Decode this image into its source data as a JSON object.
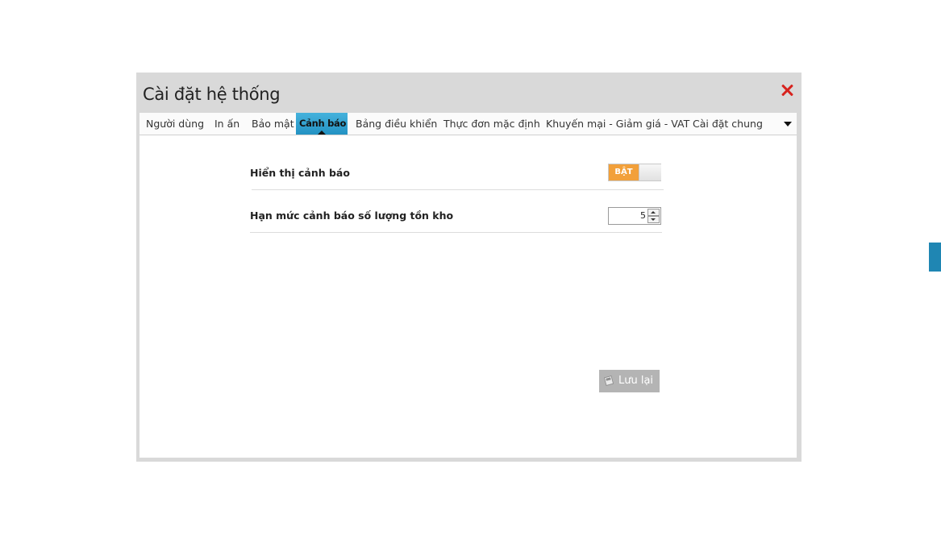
{
  "dialog": {
    "title": "Cài đặt hệ thống",
    "close_icon": "close-icon"
  },
  "tabs": [
    {
      "label": "Người dùng",
      "active": false
    },
    {
      "label": "In ấn",
      "active": false
    },
    {
      "label": "Bảo mật",
      "active": false
    },
    {
      "label": "Cảnh báo",
      "active": true
    },
    {
      "label": "Bảng điều khiển",
      "active": false
    },
    {
      "label": "Thực đơn mặc định",
      "active": false
    },
    {
      "label": "Khuyến mại - Giảm giá - VAT",
      "active": false
    },
    {
      "label": "Cài đặt chung",
      "active": false
    }
  ],
  "settings": {
    "show_warning": {
      "label": "Hiển thị cảnh báo",
      "toggle_text": "BẬT",
      "enabled": true
    },
    "stock_threshold": {
      "label": "Hạn mức cảnh báo số lượng tồn kho",
      "value": "5"
    }
  },
  "actions": {
    "save_label": "Lưu lại",
    "save_icon": "save-icon"
  },
  "colors": {
    "active_tab": "#2a9bcb",
    "toggle_on": "#f2a03a",
    "close": "#d7231e",
    "side_tab": "#1f86b3",
    "save_button": "#b4b4b4"
  }
}
